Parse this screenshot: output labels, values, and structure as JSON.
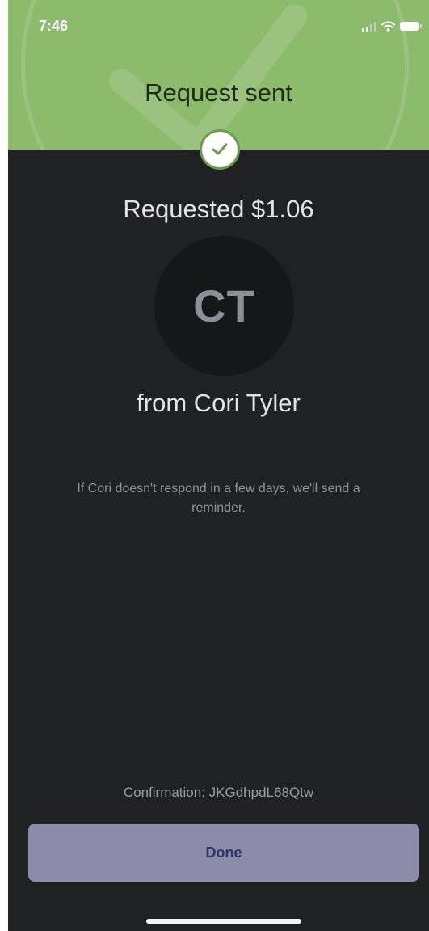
{
  "status_bar": {
    "time": "7:46",
    "signal_icon": "cellular-signal-icon",
    "wifi_icon": "wifi-icon",
    "battery_icon": "battery-icon"
  },
  "header": {
    "title": "Request sent",
    "badge_icon": "checkmark-icon",
    "background_color": "#8dbb6c"
  },
  "request": {
    "amount_text": "Requested $1.06",
    "avatar_initials": "CT",
    "from_text": "from Cori Tyler",
    "note": "If Cori doesn't respond in a few days, we'll send a reminder."
  },
  "footer": {
    "confirmation": "Confirmation: JKGdhpdL68Qtw",
    "done_label": "Done",
    "button_color": "#8a8ca9"
  }
}
